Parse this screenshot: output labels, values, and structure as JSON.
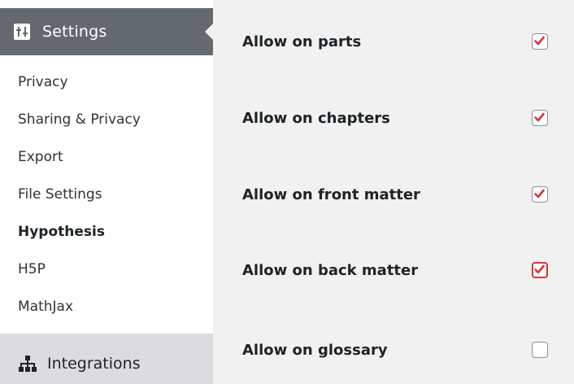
{
  "sidebar": {
    "header": {
      "label": "Settings",
      "icon": "settings-icon"
    },
    "items": [
      {
        "label": "Privacy"
      },
      {
        "label": "Sharing & Privacy"
      },
      {
        "label": "Export"
      },
      {
        "label": "File Settings"
      },
      {
        "label": "Hypothesis",
        "current": true
      },
      {
        "label": "H5P"
      },
      {
        "label": "MathJax"
      }
    ],
    "integrations": {
      "label": "Integrations",
      "icon": "network-icon"
    }
  },
  "main": {
    "options": [
      {
        "label": "Allow on parts",
        "checked": true
      },
      {
        "label": "Allow on chapters",
        "checked": true
      },
      {
        "label": "Allow on front matter",
        "checked": true
      },
      {
        "label": "Allow on back matter",
        "checked": true,
        "focused": true
      },
      {
        "label": "Allow on glossary",
        "checked": false
      }
    ]
  },
  "colors": {
    "check_mark": "#d63638",
    "header_bg": "#646970",
    "integrations_bg": "#dcdcde",
    "main_bg": "#f1f1f1"
  }
}
